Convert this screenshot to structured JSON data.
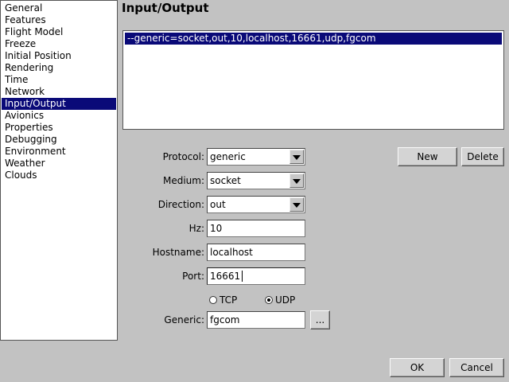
{
  "sidebar": {
    "items": [
      {
        "label": "General"
      },
      {
        "label": "Features"
      },
      {
        "label": "Flight Model"
      },
      {
        "label": "Freeze"
      },
      {
        "label": "Initial Position"
      },
      {
        "label": "Rendering"
      },
      {
        "label": "Time"
      },
      {
        "label": "Network"
      },
      {
        "label": "Input/Output"
      },
      {
        "label": "Avionics"
      },
      {
        "label": "Properties"
      },
      {
        "label": "Debugging"
      },
      {
        "label": "Environment"
      },
      {
        "label": "Weather"
      },
      {
        "label": "Clouds"
      }
    ],
    "selected": "Input/Output"
  },
  "page_title": "Input/Output",
  "config_list": {
    "entries": [
      "--generic=socket,out,10,localhost,16661,udp,fgcom"
    ]
  },
  "form": {
    "protocol": {
      "label": "Protocol:",
      "value": "generic"
    },
    "medium": {
      "label": "Medium:",
      "value": "socket"
    },
    "direction": {
      "label": "Direction:",
      "value": "out"
    },
    "hz": {
      "label": "Hz:",
      "value": "10"
    },
    "hostname": {
      "label": "Hostname:",
      "value": "localhost"
    },
    "port": {
      "label": "Port:",
      "value": "16661"
    },
    "transport": {
      "tcp_label": "TCP",
      "udp_label": "UDP",
      "selected": "UDP"
    },
    "generic": {
      "label": "Generic:",
      "value": "fgcom",
      "browse_label": "..."
    }
  },
  "buttons": {
    "new": "New",
    "delete": "Delete",
    "ok": "OK",
    "cancel": "Cancel"
  }
}
